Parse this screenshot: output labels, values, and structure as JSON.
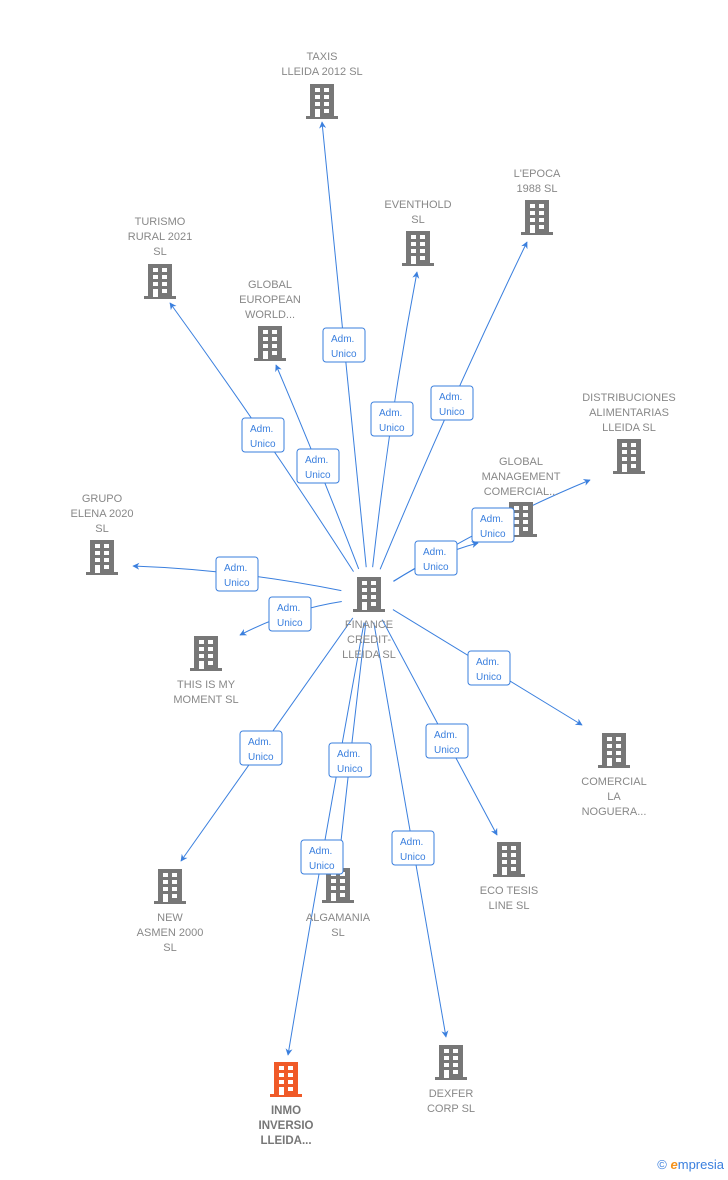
{
  "colors": {
    "edge": "#3a7fde",
    "node": "#777777",
    "highlight": "#f05a28"
  },
  "center": {
    "name_lines": [
      "FINANCE",
      "CREDIT-",
      "LLEIDA SL"
    ],
    "icon": "building-icon"
  },
  "edge_label_lines": [
    "Adm.",
    "Unico"
  ],
  "nodes": [
    {
      "name_lines": [
        "TAXIS",
        "LLEIDA 2012 SL"
      ],
      "relation": "Adm. Unico"
    },
    {
      "name_lines": [
        "L'EPOCA",
        "1988  SL"
      ],
      "relation": "Adm. Unico"
    },
    {
      "name_lines": [
        "EVENTHOLD",
        "SL"
      ],
      "relation": "Adm. Unico"
    },
    {
      "name_lines": [
        "TURISMO",
        "RURAL 2021",
        "SL"
      ],
      "relation": "Adm. Unico"
    },
    {
      "name_lines": [
        "GLOBAL",
        "EUROPEAN",
        "WORLD..."
      ],
      "relation": "Adm. Unico"
    },
    {
      "name_lines": [
        "DISTRIBUCIONES",
        "ALIMENTARIAS",
        "LLEIDA  SL"
      ],
      "relation": "Adm. Unico"
    },
    {
      "name_lines": [
        "GLOBAL",
        "MANAGEMENT",
        "COMERCIAL..."
      ],
      "relation": "Adm. Unico"
    },
    {
      "name_lines": [
        "GRUPO",
        "ELENA 2020",
        "SL"
      ],
      "relation": "Adm. Unico"
    },
    {
      "name_lines": [
        "THIS IS MY",
        "MOMENT  SL"
      ],
      "relation": "Adm. Unico"
    },
    {
      "name_lines": [
        "COMERCIAL",
        "LA",
        "NOGUERA..."
      ],
      "relation": "Adm. Unico"
    },
    {
      "name_lines": [
        "ECO TESIS",
        "LINE  SL"
      ],
      "relation": "Adm. Unico"
    },
    {
      "name_lines": [
        "NEW",
        "ASMEN 2000",
        "SL"
      ],
      "relation": "Adm. Unico"
    },
    {
      "name_lines": [
        "ALGAMANIA",
        "SL"
      ],
      "relation": "Adm. Unico"
    },
    {
      "name_lines": [
        "INMO",
        "INVERSIO",
        "LLEIDA..."
      ],
      "relation": "Adm. Unico",
      "highlighted": true
    },
    {
      "name_lines": [
        "DEXFER",
        "CORP SL"
      ],
      "relation": "Adm. Unico"
    }
  ],
  "footer": {
    "copyright": "©",
    "brand_initial": "e",
    "brand_rest": "mpresia"
  }
}
